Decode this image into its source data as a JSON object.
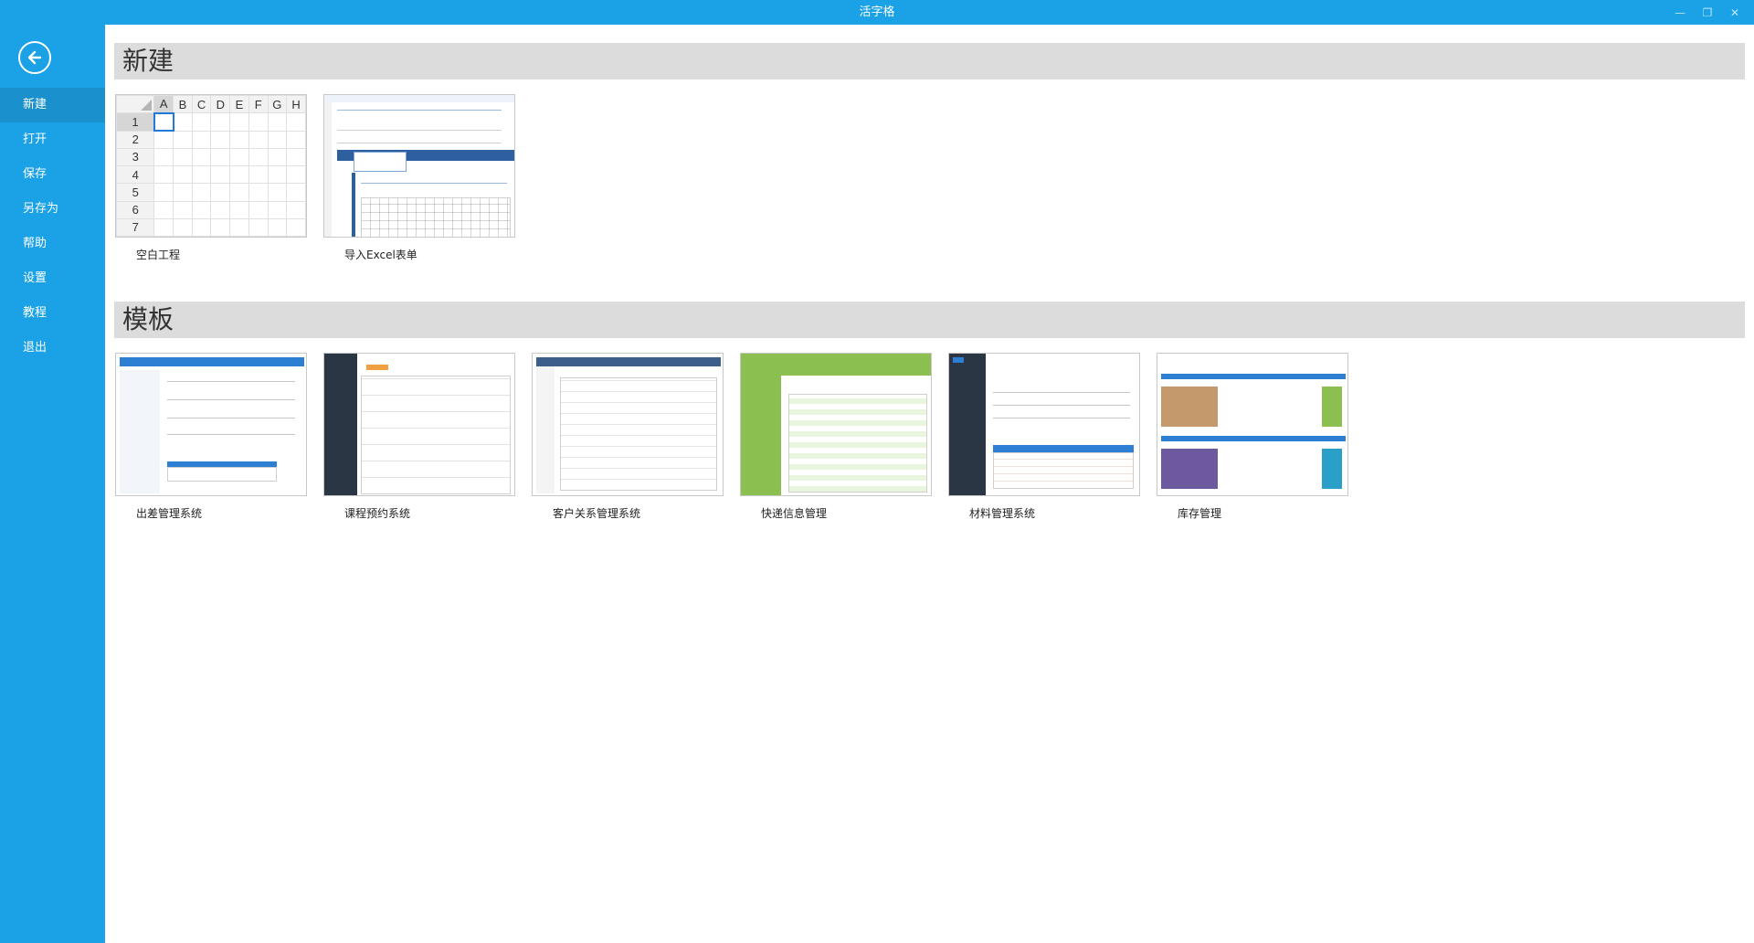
{
  "window": {
    "title": "活字格",
    "controls": [
      "minimize-icon",
      "restore-icon",
      "close-icon"
    ]
  },
  "colors": {
    "accent": "#1aa1e6",
    "active_nav": "#1a90cc",
    "section_header": "#dcdcdc"
  },
  "sidebar": {
    "back_icon": "arrow-left-circle-icon",
    "items": [
      {
        "label": "新建",
        "active": true
      },
      {
        "label": "打开"
      },
      {
        "label": "保存"
      },
      {
        "label": "另存为"
      },
      {
        "label": "帮助"
      },
      {
        "label": "设置"
      },
      {
        "label": "教程"
      },
      {
        "label": "退出"
      }
    ]
  },
  "new_section": {
    "title": "新建",
    "cards": [
      {
        "label": "空白工程",
        "grid_cols": [
          "A",
          "B",
          "C",
          "D",
          "E",
          "F",
          "G",
          "H"
        ],
        "grid_rows": [
          "1",
          "2",
          "3",
          "4",
          "5",
          "6",
          "7"
        ]
      },
      {
        "label": "导入Excel表单"
      }
    ]
  },
  "template_section": {
    "title": "模板",
    "cards": [
      {
        "label": "出差管理系统"
      },
      {
        "label": "课程预约系统"
      },
      {
        "label": "客户关系管理系统"
      },
      {
        "label": "快递信息管理"
      },
      {
        "label": "材料管理系统"
      },
      {
        "label": "库存管理"
      }
    ]
  }
}
